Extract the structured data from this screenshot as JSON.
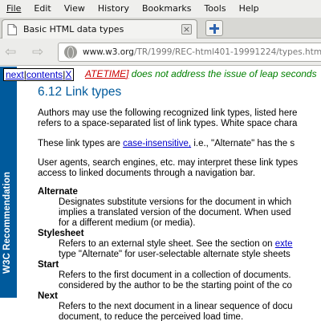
{
  "menu": [
    "File",
    "Edit",
    "View",
    "History",
    "Bookmarks",
    "Tools",
    "Help"
  ],
  "tab": {
    "title": "Basic HTML data types",
    "close_glyph": "×"
  },
  "nav": {
    "back_glyph": "⇦",
    "forward_glyph": "⇨",
    "url_host": "www.w3.org",
    "url_path": "/TR/1999/REC-html401-19991224/types.html#type-lin"
  },
  "page": {
    "sidebar_label": "W3C Recommendation",
    "nav_links": {
      "next": "next",
      "contents": "contents",
      "close": "X"
    },
    "prev_line": {
      "link": "ATETIME]",
      "rest": " does not address the issue of leap seconds"
    },
    "section_title": "6.12 Link types",
    "para1": {
      "line1": "Authors may use the following recognized link types, listed here",
      "line2": "refers to a space-separated list of link types. White space chara"
    },
    "para2": {
      "before": "These link types are ",
      "link": "case-insensitive,",
      "after": " i.e., \"Alternate\" has the s"
    },
    "para3": {
      "line1": "User agents, search engines, etc. may interpret these link types",
      "line2": "access to linked documents through a navigation bar."
    },
    "link_types": [
      {
        "term": "Alternate",
        "lines": [
          "Designates substitute versions for the document in which",
          "implies a translated version of the document. When used",
          "for a different medium (or media)."
        ]
      },
      {
        "term": "Stylesheet",
        "line1_before": "Refers to an external style sheet. See the section on ",
        "line1_link": "exte",
        "line2": "type \"Alternate\" for user-selectable alternate style sheets"
      },
      {
        "term": "Start",
        "lines": [
          "Refers to the first document in a collection of documents.",
          "considered by the author to be the starting point of the co"
        ]
      },
      {
        "term": "Next",
        "lines": [
          "Refers to the next document in a linear sequence of docu",
          "document, to reduce the perceived load time."
        ]
      }
    ]
  }
}
